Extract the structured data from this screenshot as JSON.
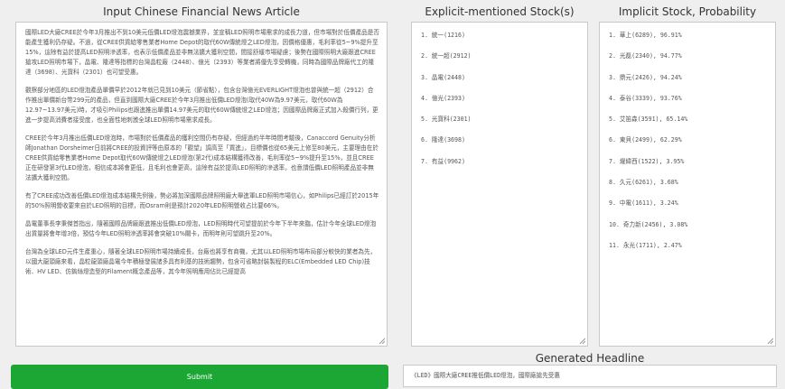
{
  "panels": {
    "article_title": "Input Chinese Financial News Article",
    "explicit_title": "Explicit-mentioned Stock(s)",
    "implicit_title": "Implicit Stock, Probability",
    "headline_title": "Generated Headline"
  },
  "article": {
    "paragraphs": [
      "國際LED大廠CREE於今年3月推出不到10美元低價LED燈泡震撼業界，並宣稱LED照明市場需求的成長力道，但市場對於低價產品是否能產生獲利仍存疑。不過，從CREE供貨給零售業者Home Depot的取代60W傳統燈之LED燈泡，因價格優惠，毛利率從5~9%提升至15%，這除有益於提高LED照明滲透率，也表示低價產品並非無法擴大獲利空間，間接舒緩市場疑慮；後勢在國際照明大廠跟進CREE搶攻LED照明市場下，晶電、隆達等指標的台灣晶粒廠（2448）、億光（2393）等業者將優先享受轉機，同時為國際品牌廠代工的隆達（3698）、光寶科（2301）也可望受惠。",
      "觀察部分地區的LED燈泡產品單價早於2012年就已見到10美元（節省點），包含台灣億光EVERLIGHT燈泡也曾與統一超（2912）合作推出單價新台幣299元的產品，但直到國際大廠CREE於今年3月推出低價LED燈泡(取代40W為9.97美元，取代60W為12.97~13.97美元)時，才吸引Philips也跟進推出單價14.97美元的取代60W傳統燈之LED燈泡；因國際品牌廠正式加入殺價行列，更進一步提高消費者接受度，也全面性地刺激全球LED照明市場需求成長。",
      "CREE於今年3月推出低價LED燈泡時，市場對於低價產品的獲利空間仍有存疑，但經過約半年時間考驗後，Canaccord Genuity分析師Jonathan Dorsheimer日前將CREE的投資評等由原本的「觀望」調高至「買進」，目標價也從65美元上修至80美元，主要理由在於CREE供貨給零售業者Home Depot取代60W傳統燈之LED燈泡(第2代)成本結構獲得改善，毛利率從5~9%提升至15%，並且CREE正在研發第3代LED燈泡，相信成本將會更低，且毛利也會更高，這除有益於提高LED照明的滲透率，也意謂低價LED照明產品並非無法擴大獲利空間。",
      "有了CREE成功改善低價LED燈泡成本結構先例後，勢必將加深國際品牌照明廠大舉進軍LED照明市場信心，如Philips已經訂於2015年的50%照明營收要來自於LED照明的目標，而Osram則是預計2020年LED照明營收占比要66%。",
      "晶電董事長李秉傑首指出，隨著國際品牌廠跟進推出低價LED燈泡，LED照明時代可望提前於今年下半年來臨，估計今年全球LED燈泡出貨量將會年增3倍，預估今年LED照明滲透率將會突破10%關卡，而明年則可望跳升至20%。",
      "台灣為全球LED元件生產重心，隨著全球LED照明市場持續成長，台廠也將享有商機，尤其以LED照明市場布局部分較快的業者為先，以國大龍頭廠來看，晶粒龍頭廠晶電今年積極發展諸多具有利基的技術趨勢，包含可省略封裝製程的ELC(Embedded LED Chip)技術、HV LED、仿鎢絲燈造型的Filament概念產品等，其今年照明應用佔比已經提高"
    ]
  },
  "explicit_stocks": [
    "1. 統一(1216)",
    "2. 統一超(2912)",
    "3. 晶電(2448)",
    "4. 億光(2393)",
    "5. 光寶科(2301)",
    "6. 隆達(3698)",
    "7. 有益(9962)"
  ],
  "implicit_stocks": [
    "1. 華上(6289), 96.91%",
    "2. 光磊(2340), 94.77%",
    "3. 鼎元(2426), 94.24%",
    "4. 泰谷(3339), 93.76%",
    "5. 艾笛森(3591), 65.14%",
    "6. 東貝(2499), 62.29%",
    "7. 燿緯西(1522), 3.95%",
    "8. 久元(6261), 3.68%",
    "9. 中電(1611), 3.24%",
    "10. 奇力新(2456), 3.08%",
    "11. 永光(1711), 2.47%"
  ],
  "headline": {
    "text": "《LED》國際大廠CREE推低價LED燈泡，國際廠搶先受惠"
  },
  "submit": {
    "label": "Submit",
    "color": "#1ca734"
  },
  "icons": {
    "resize_handle": "resize-grip-icon"
  }
}
